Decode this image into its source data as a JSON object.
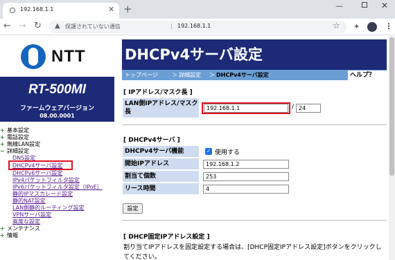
{
  "browser": {
    "tab_title": "192.168.1.1",
    "tab_close": "✕",
    "new_tab": "+",
    "security_text": "保護されていない通信",
    "separator": "|",
    "url": "192.168.1.1"
  },
  "sidebar": {
    "logo_text": "NTT",
    "model": "RT-500MI",
    "firmware_label": "ファームウェアバージョン",
    "firmware_version": "08.00.0001",
    "nav": [
      {
        "label": "基本設定",
        "level": 0
      },
      {
        "label": "電話設定",
        "level": 0
      },
      {
        "label": "無線LAN設定",
        "level": 0
      },
      {
        "label": "詳細設定",
        "level": 0
      },
      {
        "label": "DNS設定",
        "level": 1
      },
      {
        "label": "DHCPv4サーバ設定",
        "level": 1,
        "selected": true
      },
      {
        "label": "DHCPv6サーバ設定",
        "level": 1
      },
      {
        "label": "IPv4パケットフィルタ設定",
        "level": 1
      },
      {
        "label": "IPv6パケットフィルタ設定（IPoE）",
        "level": 1
      },
      {
        "label": "静的IPマスカレード設定",
        "level": 1
      },
      {
        "label": "静的NAT設定",
        "level": 1
      },
      {
        "label": "LAN側静的ルーティング設定",
        "level": 1
      },
      {
        "label": "VPNサーバ設定",
        "level": 1
      },
      {
        "label": "高度な設定",
        "level": 1
      },
      {
        "label": "メンテナンス",
        "level": 0
      },
      {
        "label": "情報",
        "level": 0
      }
    ]
  },
  "main": {
    "title": "DHCPv4サーバ設定",
    "breadcrumb": {
      "top": "トップページ",
      "sep": "＞",
      "advanced": "詳細設定",
      "current": "DHCPv4サーバ設定"
    },
    "help": "ヘルプ？",
    "section_ip": {
      "title": "[ IPアドレス/マスク長 ]",
      "label": "LAN側IPアドレス/マスク長",
      "ip_value": "192.168.1.1",
      "slash": "/",
      "mask_value": "24"
    },
    "section_dhcp": {
      "title": "[ DHCPv4サーバ ]",
      "rows": {
        "function_label": "DHCPv4サーバ機能",
        "function_checkbox": "使用する",
        "start_label": "開始IPアドレス",
        "start_value": "192.168.1.2",
        "count_label": "割当て個数",
        "count_value": "253",
        "lease_label": "リース時間",
        "lease_value": "4"
      },
      "submit": "設定"
    },
    "section_fixed": {
      "title": "[ DHCP固定IPアドレス設定 ]",
      "description": "割り当てIPアドレスを固定設定する場合は、[DHCP固定IPアドレス設定]ボタンをクリックしてください。"
    }
  },
  "colors": {
    "header_navy": "#1d2a78",
    "breadcrumb_blue": "#6a9ed4",
    "label_bg": "#cfdcef",
    "highlight_red": "#e01020"
  }
}
